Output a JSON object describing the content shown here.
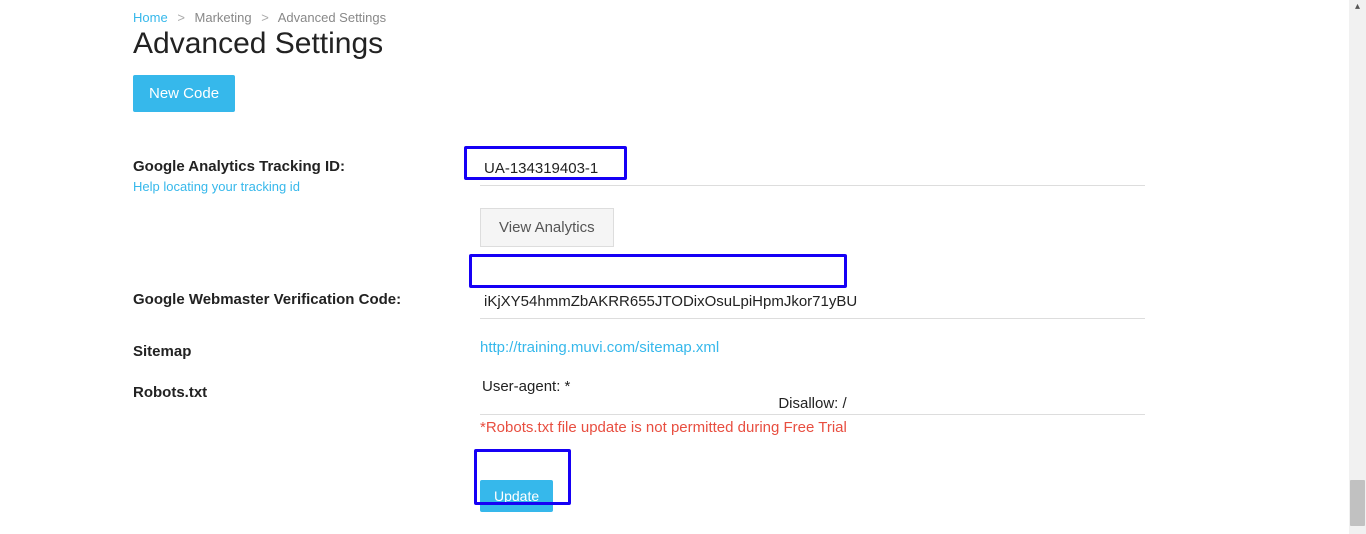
{
  "breadcrumb": {
    "home": "Home",
    "marketing": "Marketing",
    "current": "Advanced Settings"
  },
  "page_title": "Advanced Settings",
  "buttons": {
    "new_code": "New Code",
    "view_analytics": "View Analytics",
    "update": "Update"
  },
  "labels": {
    "ga_tracking": "Google Analytics Tracking ID:",
    "ga_help": "Help locating your tracking id",
    "webmaster": "Google Webmaster Verification Code:",
    "sitemap": "Sitemap",
    "robots": "Robots.txt"
  },
  "fields": {
    "ga_tracking_value": "UA-134319403-1",
    "webmaster_value": "iKjXY54hmmZbAKRR655JTODixOsuLpiHpmJkor71yBU",
    "sitemap_url": "http://training.muvi.com/sitemap.xml",
    "robots_line1": "User-agent: *",
    "robots_line2": "Disallow: /",
    "robots_warning": "*Robots.txt file update is not permitted during Free Trial"
  },
  "annotation_color": "#1600f5"
}
